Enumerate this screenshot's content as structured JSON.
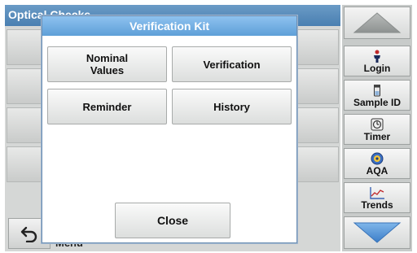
{
  "background": {
    "title": "Optical Checks",
    "menu_label": "Menu"
  },
  "dialog": {
    "title": "Verification Kit",
    "buttons": {
      "nominal_values": "Nominal\nValues",
      "verification": "Verification",
      "reminder": "Reminder",
      "history": "History",
      "close": "Close"
    }
  },
  "side_panel": {
    "login": "Login",
    "sample_id": "Sample ID",
    "timer": "Timer",
    "aqa": "AQA",
    "trends": "Trends"
  },
  "colors": {
    "dialog_title_bg": "#5e9fd8",
    "arrow_blue": "#4a8fd4"
  },
  "icons": [
    "up-arrow-icon",
    "down-arrow-icon",
    "person-icon",
    "sample-id-icon",
    "timer-icon",
    "aqa-icon",
    "trends-icon",
    "back-arrow-icon"
  ]
}
